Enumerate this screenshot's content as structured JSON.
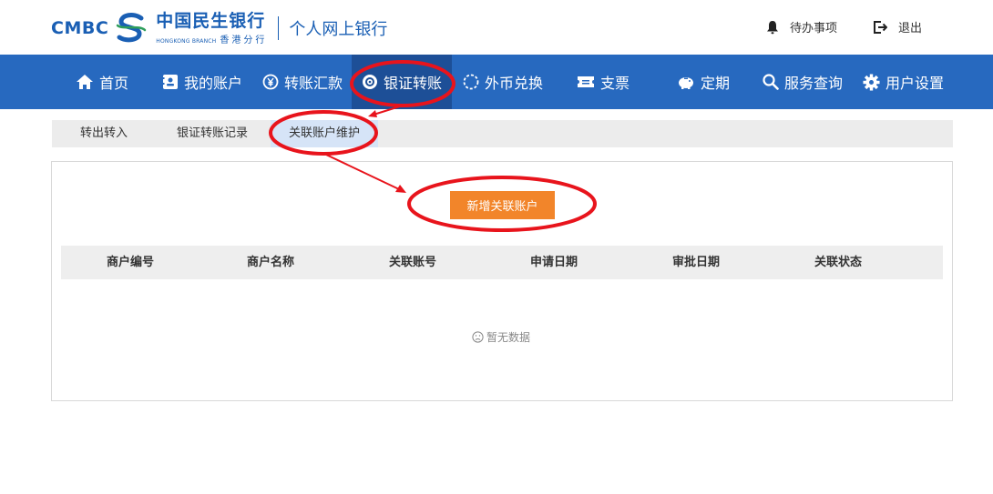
{
  "header": {
    "brand_en": "CMBC",
    "brand_cn": "中国民生银行",
    "brand_sub_en": "HONGKONG BRANCH",
    "brand_sub_cn": "香港分行",
    "product": "个人网上银行",
    "todo_label": "待办事项",
    "logout_label": "退出"
  },
  "nav": {
    "items": [
      {
        "label": "首页",
        "icon": "home-icon"
      },
      {
        "label": "我的账户",
        "icon": "account-book-icon"
      },
      {
        "label": "转账汇款",
        "icon": "yen-circle-icon"
      },
      {
        "label": "银证转账",
        "icon": "securities-icon",
        "active": true
      },
      {
        "label": "外币兑换",
        "icon": "exchange-icon"
      },
      {
        "label": "支票",
        "icon": "cheque-icon"
      },
      {
        "label": "定期",
        "icon": "piggy-bank-icon"
      },
      {
        "label": "服务查询",
        "icon": "search-icon"
      },
      {
        "label": "用户设置",
        "icon": "gear-icon"
      }
    ]
  },
  "subtabs": {
    "items": [
      {
        "label": "转出转入"
      },
      {
        "label": "银证转账记录"
      },
      {
        "label": "关联账户维护",
        "active": true
      }
    ]
  },
  "panel": {
    "add_button": "新增关联账户",
    "columns": [
      "商户编号",
      "商户名称",
      "关联账号",
      "申请日期",
      "审批日期",
      "关联状态"
    ],
    "rows": [],
    "empty_text": "暂无数据"
  },
  "colors": {
    "brand_blue": "#1a5fb4",
    "nav_bg": "#2769bf",
    "nav_active": "#1d4f97",
    "button_orange": "#f2852a",
    "annotation_red": "#e8141c"
  }
}
